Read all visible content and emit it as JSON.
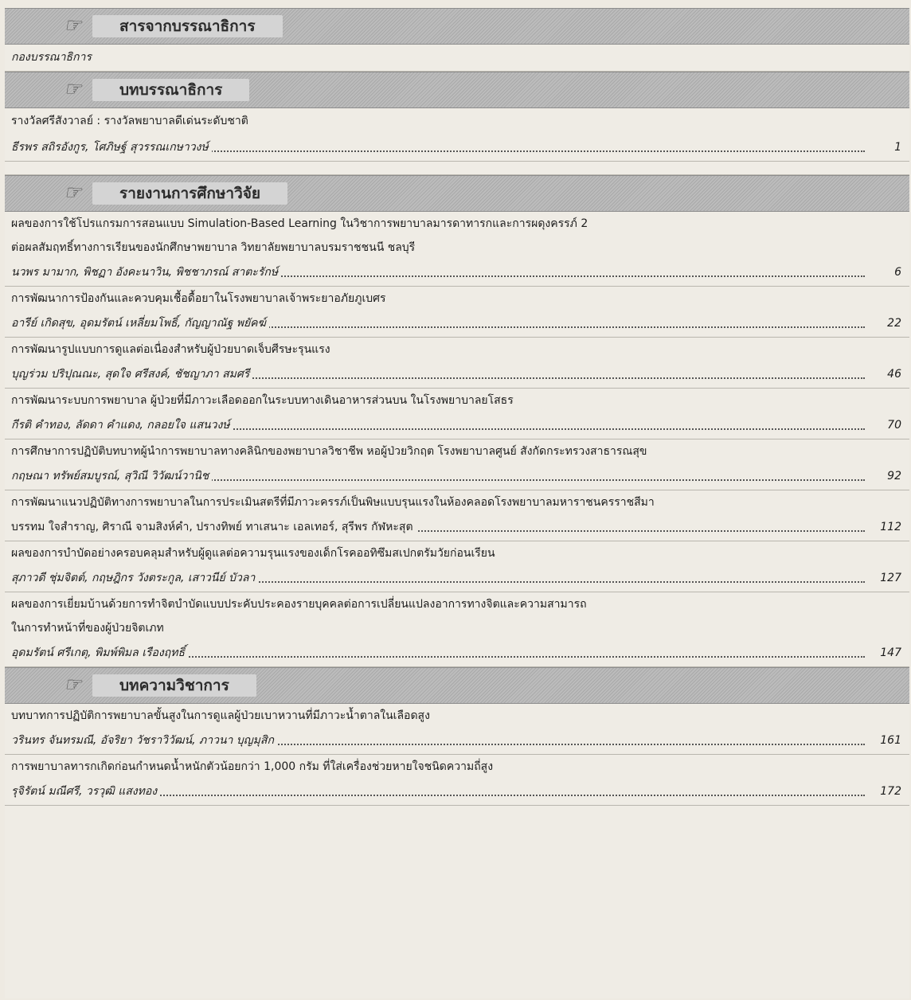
{
  "sections": [
    {
      "title": "สารจากบรรณาธิการ",
      "entries": [
        {
          "title_lines": [],
          "authors": "กองบรรณาธิการ",
          "page": ""
        }
      ]
    },
    {
      "title": "บทบรรณาธิการ",
      "entries": [
        {
          "title_lines": [
            "รางวัลศรีสังวาลย์ : รางวัลพยาบาลดีเด่นระดับชาติ"
          ],
          "authors": "ธีรพร สถิรอังกูร, โศภิษฐ์ สุวรรณเกษาวงษ์",
          "page": "1"
        }
      ]
    },
    {
      "title": "รายงานการศึกษาวิจัย",
      "entries": [
        {
          "title_lines": [
            "ผลของการใช้โปรแกรมการสอนแบบ Simulation-Based Learning ในวิชาการพยาบาลมารดาทารกและการผดุงครรภ์ 2",
            "ต่อผลสัมฤทธิ์ทางการเรียนของนักศึกษาพยาบาล วิทยาลัยพยาบาลบรมราชชนนี ชลบุรี"
          ],
          "authors": "นวพร มามาก, พิชฏา อังคะนาวิน, พิชชาภรณ์ สาตะรักษ์",
          "page": "6"
        },
        {
          "title_lines": [
            "การพัฒนาการป้องกันและควบคุมเชื้อดื้อยาในโรงพยาบาลเจ้าพระยาอภัยภูเบศร"
          ],
          "authors": "อารีย์ เกิดสุข, อุดมรัตน์ เหลี่ยมโพธิ์, กัญญาณัฐ พยัคฆ์",
          "page": "22"
        },
        {
          "title_lines": [
            "การพัฒนารูปแบบการดูแลต่อเนื่องสำหรับผู้ป่วยบาดเจ็บศีรษะรุนแรง"
          ],
          "authors": "บุญร่วม ปริปุณณะ, สุดใจ ศรีสงค์, ชัชญาภา สมศรี",
          "page": "46"
        },
        {
          "title_lines": [
            "การพัฒนาระบบการพยาบาล ผู้ป่วยที่มีภาวะเลือดออกในระบบทางเดินอาหารส่วนบน ในโรงพยาบาลยโสธร"
          ],
          "authors": "กีรติ คำทอง, ลัดดา คำแดง, กลอยใจ แสนวงษ์",
          "page": "70"
        },
        {
          "title_lines": [
            "การศึกษาการปฏิบัติบทบาทผู้นำการพยาบาลทางคลินิกของพยาบาลวิชาชีพ หอผู้ป่วยวิกฤต โรงพยาบาลศูนย์ สังกัดกระทรวงสาธารณสุข"
          ],
          "authors": "กฤษณา ทรัพย์สมบูรณ์, สุวิณี วิวัฒน์วานิช",
          "page": "92"
        },
        {
          "title_lines": [
            "การพัฒนาแนวปฏิบัติทางการพยาบาลในการประเมินสตรีที่มีภาวะครรภ์เป็นพิษแบบรุนแรงในห้องคลอดโรงพยาบาลมหาราชนครราชสีมา"
          ],
          "authors": "บรรทม ใจสำราญ, ศิราณี จามสิงห์คำ, ปรางทิพย์ ทาเสนาะ เอลเทอร์, สุรีพร กัฬหะสุต",
          "page": "112",
          "plain": true
        },
        {
          "title_lines": [
            "ผลของการบำบัดอย่างครอบคลุมสำหรับผู้ดูแลต่อความรุนแรงของเด็กโรคออทิซึมสเปกตรัมวัยก่อนเรียน"
          ],
          "authors": "สุภาวดี ชุ่มจิตต์, กฤษฎิกร วังตระกูล, เสาวนีย์ บัวลา",
          "page": "127"
        },
        {
          "title_lines": [
            "ผลของการเยี่ยมบ้านด้วยการทำจิตบำบัดแบบประคับประคองรายบุคคลต่อการเปลี่ยนแปลงอาการทางจิตและความสามารถ",
            "ในการทำหน้าที่ของผู้ป่วยจิตเภท"
          ],
          "authors": "อุดมรัตน์ ศรีเกตุ, พิมพ์พิมล เรืองฤทธิ์",
          "page": "147"
        }
      ]
    },
    {
      "title": "บทความวิชาการ",
      "entries": [
        {
          "title_lines": [
            "บทบาทการปฏิบัติการพยาบาลขั้นสูงในการดูแลผู้ป่วยเบาหวานที่มีภาวะน้ำตาลในเลือดสูง"
          ],
          "authors": "วรินทร จันทรมณี, อัจริยา วัชราวิวัฒน์, ภาวนา บุญมุสิก",
          "page": "161"
        },
        {
          "title_lines": [
            "การพยาบาลทารกเกิดก่อนกำหนดน้ำหนักตัวน้อยกว่า 1,000 กรัม ที่ใส่เครื่องช่วยหายใจชนิดความถี่สูง"
          ],
          "authors": "รุจิรัตน์ มณีศรี, วรวุฒิ แสงทอง",
          "page": "172"
        }
      ]
    }
  ],
  "icon": "pointing-hand-icon"
}
